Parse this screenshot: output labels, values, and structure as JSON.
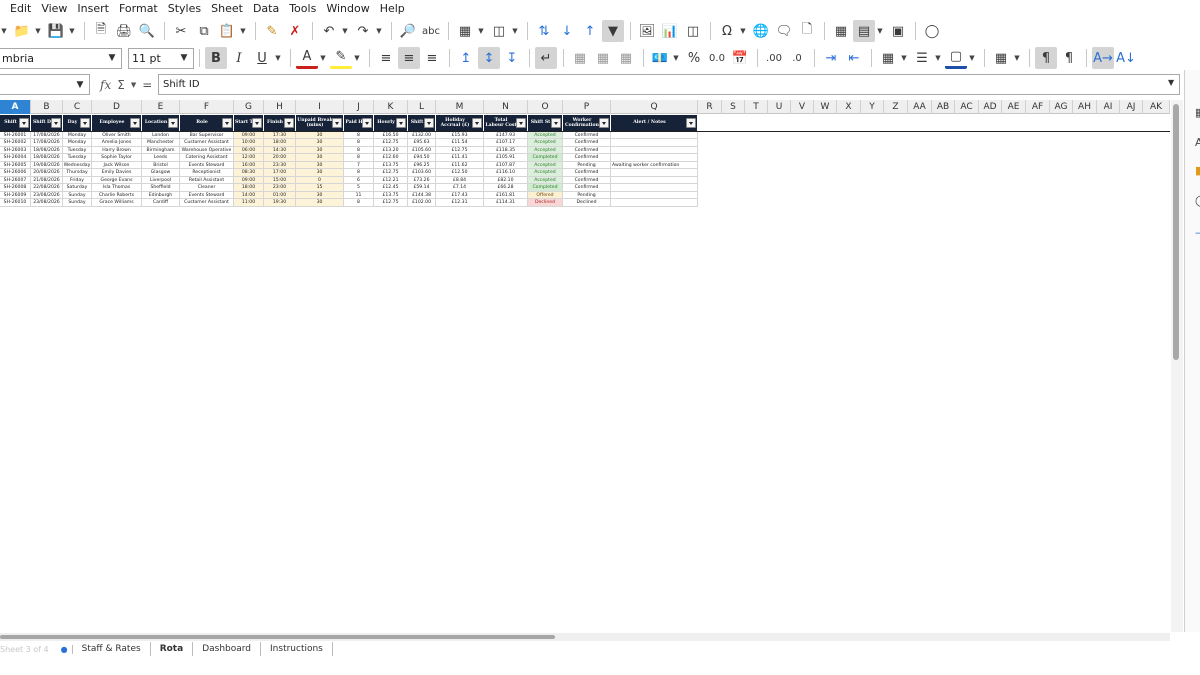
{
  "menu": [
    "Edit",
    "View",
    "Insert",
    "Format",
    "Styles",
    "Sheet",
    "Data",
    "Tools",
    "Window",
    "Help"
  ],
  "toolbar": {
    "font_name": "mbria",
    "font_size": "11 pt",
    "bold_label": "B",
    "italic_label": "I",
    "underline_label": "U",
    "font_color_label": "A",
    "percent_label": "%",
    "number_label": "0.0",
    "add_decimal_label": ".00",
    "remove_decimal_label": ".0"
  },
  "formula_bar": {
    "name_box": "",
    "function_label": "fx",
    "sum_label": "Σ",
    "equals_label": "=",
    "content": "Shift ID"
  },
  "columns": [
    "A",
    "B",
    "C",
    "D",
    "E",
    "F",
    "G",
    "H",
    "I",
    "J",
    "K",
    "L",
    "M",
    "N",
    "O",
    "P",
    "Q",
    "R",
    "S",
    "T",
    "U",
    "V",
    "W",
    "X",
    "Y",
    "Z",
    "AA",
    "AB",
    "AC",
    "AD",
    "AE",
    "AF",
    "AG",
    "AH",
    "AI",
    "AJ",
    "AK"
  ],
  "selected_column": "A",
  "table": {
    "headers": [
      "Shift",
      "Shift D",
      "Day",
      "Employee",
      "Location",
      "Role",
      "Start T",
      "Finish",
      "Unpaid Break (mins)",
      "Paid H",
      "Hourly",
      "Shift",
      "Holiday Accrual (£)",
      "Total Labour Cost",
      "Shift St",
      "Worker Confirmation",
      "Alert / Notes"
    ],
    "rows": [
      [
        "SH-26001",
        "17/08/2026",
        "Monday",
        "Oliver Smith",
        "London",
        "Bar Supervisor",
        "09:00",
        "17:30",
        "30",
        "8",
        "£16.50",
        "£132.00",
        "£15.93",
        "£147.93",
        "Accepted",
        "Confirmed",
        ""
      ],
      [
        "SH-26002",
        "17/08/2026",
        "Monday",
        "Amelia Jones",
        "Manchester",
        "Customer Assistant",
        "10:00",
        "18:00",
        "30",
        "8",
        "£12.75",
        "£95.63",
        "£11.54",
        "£107.17",
        "Accepted",
        "Confirmed",
        ""
      ],
      [
        "SH-26003",
        "18/08/2026",
        "Tuesday",
        "Harry Brown",
        "Birmingham",
        "Warehouse Operative",
        "06:00",
        "14:30",
        "30",
        "8",
        "£13.20",
        "£105.60",
        "£12.75",
        "£118.35",
        "Accepted",
        "Confirmed",
        ""
      ],
      [
        "SH-26004",
        "18/08/2026",
        "Tuesday",
        "Sophie Taylor",
        "Leeds",
        "Catering Assistant",
        "12:00",
        "20:00",
        "30",
        "8",
        "£12.60",
        "£94.50",
        "£11.41",
        "£105.91",
        "Completed",
        "Confirmed",
        ""
      ],
      [
        "SH-26005",
        "19/08/2026",
        "Wednesday",
        "Jack Wilson",
        "Bristol",
        "Events Steward",
        "16:00",
        "23:30",
        "30",
        "7",
        "£13.75",
        "£96.25",
        "£11.62",
        "£107.87",
        "Accepted",
        "Pending",
        "Awaiting worker confirmation"
      ],
      [
        "SH-26006",
        "20/08/2026",
        "Thursday",
        "Emily Davies",
        "Glasgow",
        "Receptionist",
        "08:30",
        "17:00",
        "30",
        "8",
        "£12.75",
        "£103.60",
        "£12.50",
        "£116.10",
        "Accepted",
        "Confirmed",
        ""
      ],
      [
        "SH-26007",
        "21/08/2026",
        "Friday",
        "George Evans",
        "Liverpool",
        "Retail Assistant",
        "09:00",
        "15:00",
        "0",
        "6",
        "£12.21",
        "£73.26",
        "£8.84",
        "£82.10",
        "Accepted",
        "Confirmed",
        ""
      ],
      [
        "SH-26008",
        "22/08/2026",
        "Saturday",
        "Isla Thomas",
        "Sheffield",
        "Cleaner",
        "18:00",
        "23:00",
        "15",
        "5",
        "£12.45",
        "£59.14",
        "£7.14",
        "£66.28",
        "Completed",
        "Confirmed",
        ""
      ],
      [
        "SH-26009",
        "23/08/2026",
        "Sunday",
        "Charlie Roberts",
        "Edinburgh",
        "Events Steward",
        "14:00",
        "01:00",
        "30",
        "11",
        "£13.75",
        "£144.38",
        "£17.43",
        "£161.81",
        "Offered",
        "Pending",
        ""
      ],
      [
        "SH-26010",
        "23/08/2026",
        "Sunday",
        "Grace Williams",
        "Cardiff",
        "Customer Assistant",
        "11:00",
        "19:30",
        "30",
        "8",
        "£12.75",
        "£102.00",
        "£12.31",
        "£114.31",
        "Declined",
        "Declined",
        ""
      ]
    ]
  },
  "sheet_tabs": {
    "status_text": "Sheet 3 of 4",
    "tabs": [
      "Staff & Rates",
      "Rota",
      "Dashboard",
      "Instructions"
    ],
    "active": "Rota"
  },
  "colors": {
    "header_bg": "#152238",
    "selected_col": "#2e84d3",
    "input_cell": "#fdf3d8",
    "accepted": "#dcefdc",
    "declined": "#f8d7d7",
    "offered": "#fcefd2"
  }
}
